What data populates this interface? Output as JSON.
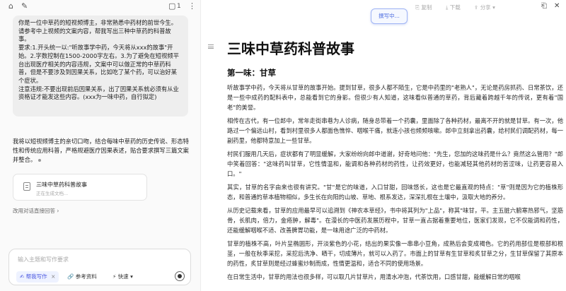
{
  "left_panel": {
    "toolbar": {
      "new_icon": "⌂",
      "edit_icon": "✎",
      "count": "1"
    },
    "user_message": "你是一位中草药的短视频博主，非常熟悉中药材的前世今生。请参考中上视频的文案内容，帮我写出三种中草药的科普故事。\n要求:1.开头统一以:\"听故事学中药，今天将从xxx的故事\"开始。2.字数控制在1500-2000字左右。3.为了避免在短视频平台出现医疗相关的内容违规，文案中可以做正常的中草药科普，但是不要涉及到因果关系，比如吃了某个药，可以治好某个症状。\n注意违规:不要出现前后因果关系，出了因果关系就必须有从业资格证才能发这些内容。(xxx为一味中药，自行拟定)",
    "reply": "我将以短视频博主的亲切口吻，结合每味中草药的历史传说、形态特性和传统应用科普，严格规避医疗因果表述，贴合要求撰写三篇文案并整合。",
    "doc_card": {
      "title": "三味中草药科普故事",
      "subtitle": "正在生成文档..."
    },
    "guide_link": "改用对话直接回答 ›",
    "input": {
      "placeholder": "输入主题和写作要求",
      "chip_active": "帮我写作",
      "chip_close": "×",
      "chip_ref": "参考资料",
      "chip_fast": "快速"
    }
  },
  "right_panel": {
    "toolbar": {
      "copy": "复制",
      "download": "下载",
      "share": "分享",
      "writing": "撰写中..."
    },
    "title": "三味中草药科普故事",
    "section1": "第一味：甘草",
    "paragraphs": [
      "听故事学中药，今天将从甘草的故事开始。提到甘草，很多人都不陌生，它是中药里的\"老熟人\"，无论是药房抓药、日常茶饮，还是一些中成药的配料表中，总能看到它的身影。但很少有人知道，这味看似普通的草药，背后藏着跨越千年的传说，更有着\"国老\"的美誉。",
      "相传在古代，有一位郎中，常年走街串巷为人诊病，随身总带着一个药囊，里面除了各种药材，最离不开的就是甘草。有一次，他路过一个偏远山村，看到村里很多人都面色憔悴、咽喉干痛，就连小孩也频频咳嗽。郎中立刻拿出药囊，给村民们调配药材，每一副药里，他都特意加上一些甘草。",
      "村民们服用几天后，症状都有了明显缓解，大家纷纷向郎中道谢，好奇地问他：\"先生，您加的这味药是什么？竟然这么管用？\"郎中笑着回答：\"这味药叫甘草，它性情温和，能调和各种药材的药性，让药效更好，也能减轻其他药材的苦涩味，让药更容易入口。\"",
      "其实，甘草的名字由来也很有讲究。\"甘\"是它的味道，入口甘甜，回味悠长，这也是它最直观的特点：\"草\"则是因为它的植株形态，和普通的草本植物相似，多生长在向阳的山坡、草地、根系发达，深深扎根在土壤中，汲取大地的养分。",
      "从历史记载来看，甘草的应用最早可以追溯到《神农本草经》，书中将其列为\"上品\"，称其\"味甘，平。主五脏六腑寒热邪气，坚筋骨，长肌肉，倍力，金疮肿，解毒\"。在漫长的中医药发展历程中，甘草一直占据着重要地位，医家们发现，它不仅能调和药性，还能缓解咽喉不适、改善脾胃功能，是一味用途广泛的中药材。",
      "甘草的植株不高，叶片呈椭圆形，开淡紫色的小花，结出的果实像一串串小豆角，成熟后会变成褐色。它的药用部位是根部和根茎，一般在秋季采挖，采挖后洗净、晒干，切成薄片，就可以入药了。市面上的甘草有生甘草和炙甘草之分，生甘草保留了其原本的药性，炙甘草则是经过蜂蜜炒制而成，性情更温和，适合不同的使用场景。",
      "在日常生活中，甘草的用法也很多样，可以取几片甘草片，用清水冲泡，代茶饮用，口感甘甜，能缓解日常的咽喉"
    ]
  }
}
